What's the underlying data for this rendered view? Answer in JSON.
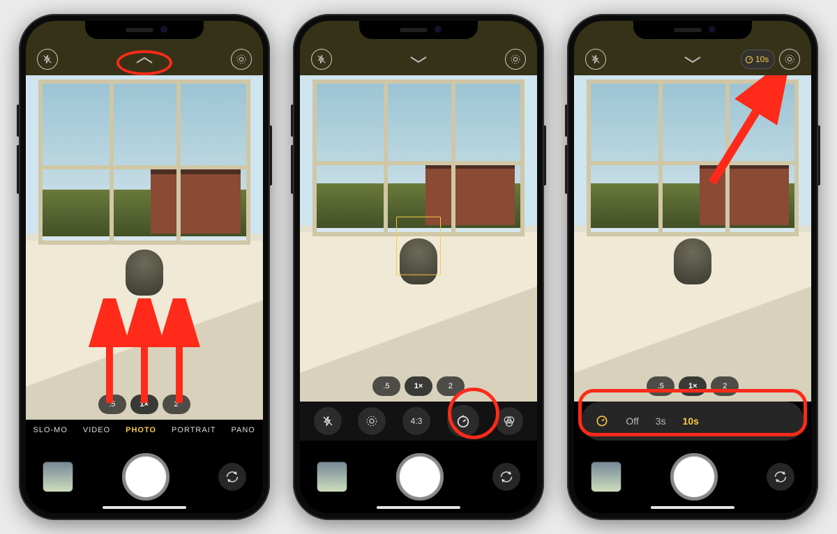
{
  "zoom": {
    "a": ".5",
    "b": "1×",
    "c": "2",
    "selected": "1×"
  },
  "modes": [
    "SLO-MO",
    "VIDEO",
    "PHOTO",
    "PORTRAIT",
    "PANO"
  ],
  "selected_mode": "PHOTO",
  "tools": {
    "aspect": "4:3"
  },
  "timer": {
    "options": [
      "Off",
      "3s",
      "10s"
    ],
    "selected": "10s",
    "indicator_label": "10s"
  },
  "icons": {
    "flash_off": "flash-off-icon",
    "live_photo": "live-photo-icon",
    "chevron_up": "chevron-up-icon",
    "chevron_down": "chevron-down-icon",
    "timer": "timer-icon",
    "filters": "filters-icon",
    "flip": "camera-flip-icon"
  },
  "annotations": {
    "s1_ellipse": "highlight-chevron",
    "s1_arrows": "swipe-up-arrows",
    "s2_circle": "highlight-timer-tool",
    "s3_arrow": "point-to-timer-indicator",
    "s3_rect": "highlight-timer-panel"
  }
}
